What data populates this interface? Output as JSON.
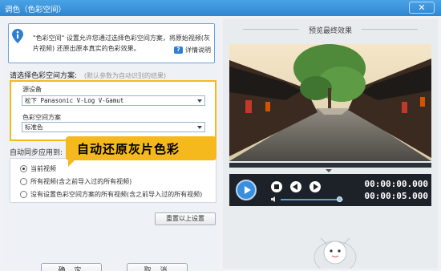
{
  "window": {
    "title": "调色（色彩空间）",
    "close_label": "✕"
  },
  "info": {
    "text": "\"色彩空间\" 设置允许您通过选择色彩空间方案，将原始视频(灰片视频) 还原出原本真实的色彩效果。",
    "help_label": "详情说明"
  },
  "color_space": {
    "section_label": "请选择色彩空间方案:",
    "section_hint": "(默认参数为自动识别的结果)",
    "source_label": "源设备",
    "source_value": "松下 Panasonic V-Log V-Gamut",
    "scheme_label": "色彩空间方案",
    "scheme_value": "标准色"
  },
  "sync": {
    "label": "自动同步应用到:",
    "options": [
      {
        "label": "当前视频",
        "selected": true
      },
      {
        "label": "所有视频(含之前导入过的所有视频)",
        "selected": false
      },
      {
        "label": "没有设置色彩空间方案的所有视频(含之前导入过的所有视频)",
        "selected": false
      }
    ]
  },
  "callout": {
    "text": "自动还原灰片色彩"
  },
  "buttons": {
    "reset": "重置以上设置",
    "ok": "确 定",
    "cancel": "取 消"
  },
  "preview": {
    "title": "预览最终效果",
    "current_time": "00:00:00.000",
    "total_time": "00:00:05.000",
    "progress": 0.0,
    "volume": 0.93
  },
  "colors": {
    "accent": "#3a8ee0",
    "title_bar": "#2f86d0",
    "highlight": "#f5b91e"
  }
}
